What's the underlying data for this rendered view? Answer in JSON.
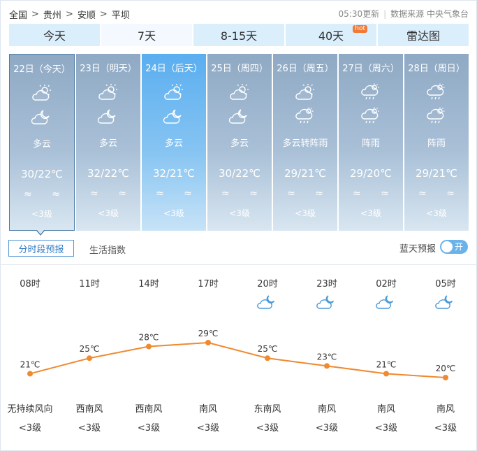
{
  "breadcrumb": [
    "全国",
    "贵州",
    "安顺",
    "平坝"
  ],
  "breadcrumb_sep": ">",
  "update_time": "05:30更新",
  "source_label": "数据来源 中央气象台",
  "tabs": [
    {
      "label": "今天"
    },
    {
      "label": "7天",
      "active": true
    },
    {
      "label": "8-15天"
    },
    {
      "label": "40天",
      "badge": "hot"
    },
    {
      "label": "雷达图"
    }
  ],
  "days": [
    {
      "date": "22日（今天）",
      "icon_day": "partly-cloudy-day-icon",
      "icon_night": "partly-cloudy-night-icon",
      "condition": "多云",
      "temp": "30/22℃",
      "wind": "≈ ≈",
      "level": "<3级"
    },
    {
      "date": "23日（明天）",
      "icon_day": "partly-cloudy-day-icon",
      "icon_night": "partly-cloudy-night-icon",
      "condition": "多云",
      "temp": "32/22℃",
      "wind": "≈ ≈",
      "level": "<3级"
    },
    {
      "date": "24日（后天）",
      "icon_day": "partly-cloudy-day-icon",
      "icon_night": "partly-cloudy-night-icon",
      "condition": "多云",
      "temp": "32/21℃",
      "wind": "≈ ≈",
      "level": "<3级"
    },
    {
      "date": "25日（周四）",
      "icon_day": "partly-cloudy-day-icon",
      "icon_night": "partly-cloudy-night-icon",
      "condition": "多云",
      "temp": "30/22℃",
      "wind": "≈ ≈",
      "level": "<3级"
    },
    {
      "date": "26日（周五）",
      "icon_day": "partly-cloudy-day-icon",
      "icon_night": "shower-icon",
      "condition": "多云转阵雨",
      "temp": "29/21℃",
      "wind": "≈ ≈",
      "level": "<3级"
    },
    {
      "date": "27日（周六）",
      "icon_day": "shower-icon",
      "icon_night": "shower-icon",
      "condition": "阵雨",
      "temp": "29/20℃",
      "wind": "≈ ≈",
      "level": "<3级"
    },
    {
      "date": "28日（周日）",
      "icon_day": "shower-icon",
      "icon_night": "shower-icon",
      "condition": "阵雨",
      "temp": "29/21℃",
      "wind": "≈ ≈",
      "level": "<3级"
    }
  ],
  "sub_tabs": [
    "分时段预报",
    "生活指数"
  ],
  "blue_sky_label": "蓝天预报",
  "toggle_label": "开",
  "hourly": [
    {
      "time": "08时",
      "temp": 21,
      "temp_label": "21℃",
      "wind": "无持续风向",
      "level": "<3级",
      "icon": ""
    },
    {
      "time": "11时",
      "temp": 25,
      "temp_label": "25℃",
      "wind": "西南风",
      "level": "<3级",
      "icon": ""
    },
    {
      "time": "14时",
      "temp": 28,
      "temp_label": "28℃",
      "wind": "西南风",
      "level": "<3级",
      "icon": ""
    },
    {
      "time": "17时",
      "temp": 29,
      "temp_label": "29℃",
      "wind": "南风",
      "level": "<3级",
      "icon": ""
    },
    {
      "time": "20时",
      "temp": 25,
      "temp_label": "25℃",
      "wind": "东南风",
      "level": "<3级",
      "icon": "partly-cloudy-night-icon"
    },
    {
      "time": "23时",
      "temp": 23,
      "temp_label": "23℃",
      "wind": "南风",
      "level": "<3级",
      "icon": "partly-cloudy-night-icon"
    },
    {
      "time": "02时",
      "temp": 21,
      "temp_label": "21℃",
      "wind": "南风",
      "level": "<3级",
      "icon": "partly-cloudy-night-icon"
    },
    {
      "time": "05时",
      "temp": 20,
      "temp_label": "20℃",
      "wind": "南风",
      "level": "<3级",
      "icon": "partly-cloudy-night-icon"
    }
  ],
  "colors": {
    "line": "#f08a30",
    "tab_bg": "#dbeefc",
    "highlight": "#5aaef0",
    "accent": "#2f7bc5"
  }
}
